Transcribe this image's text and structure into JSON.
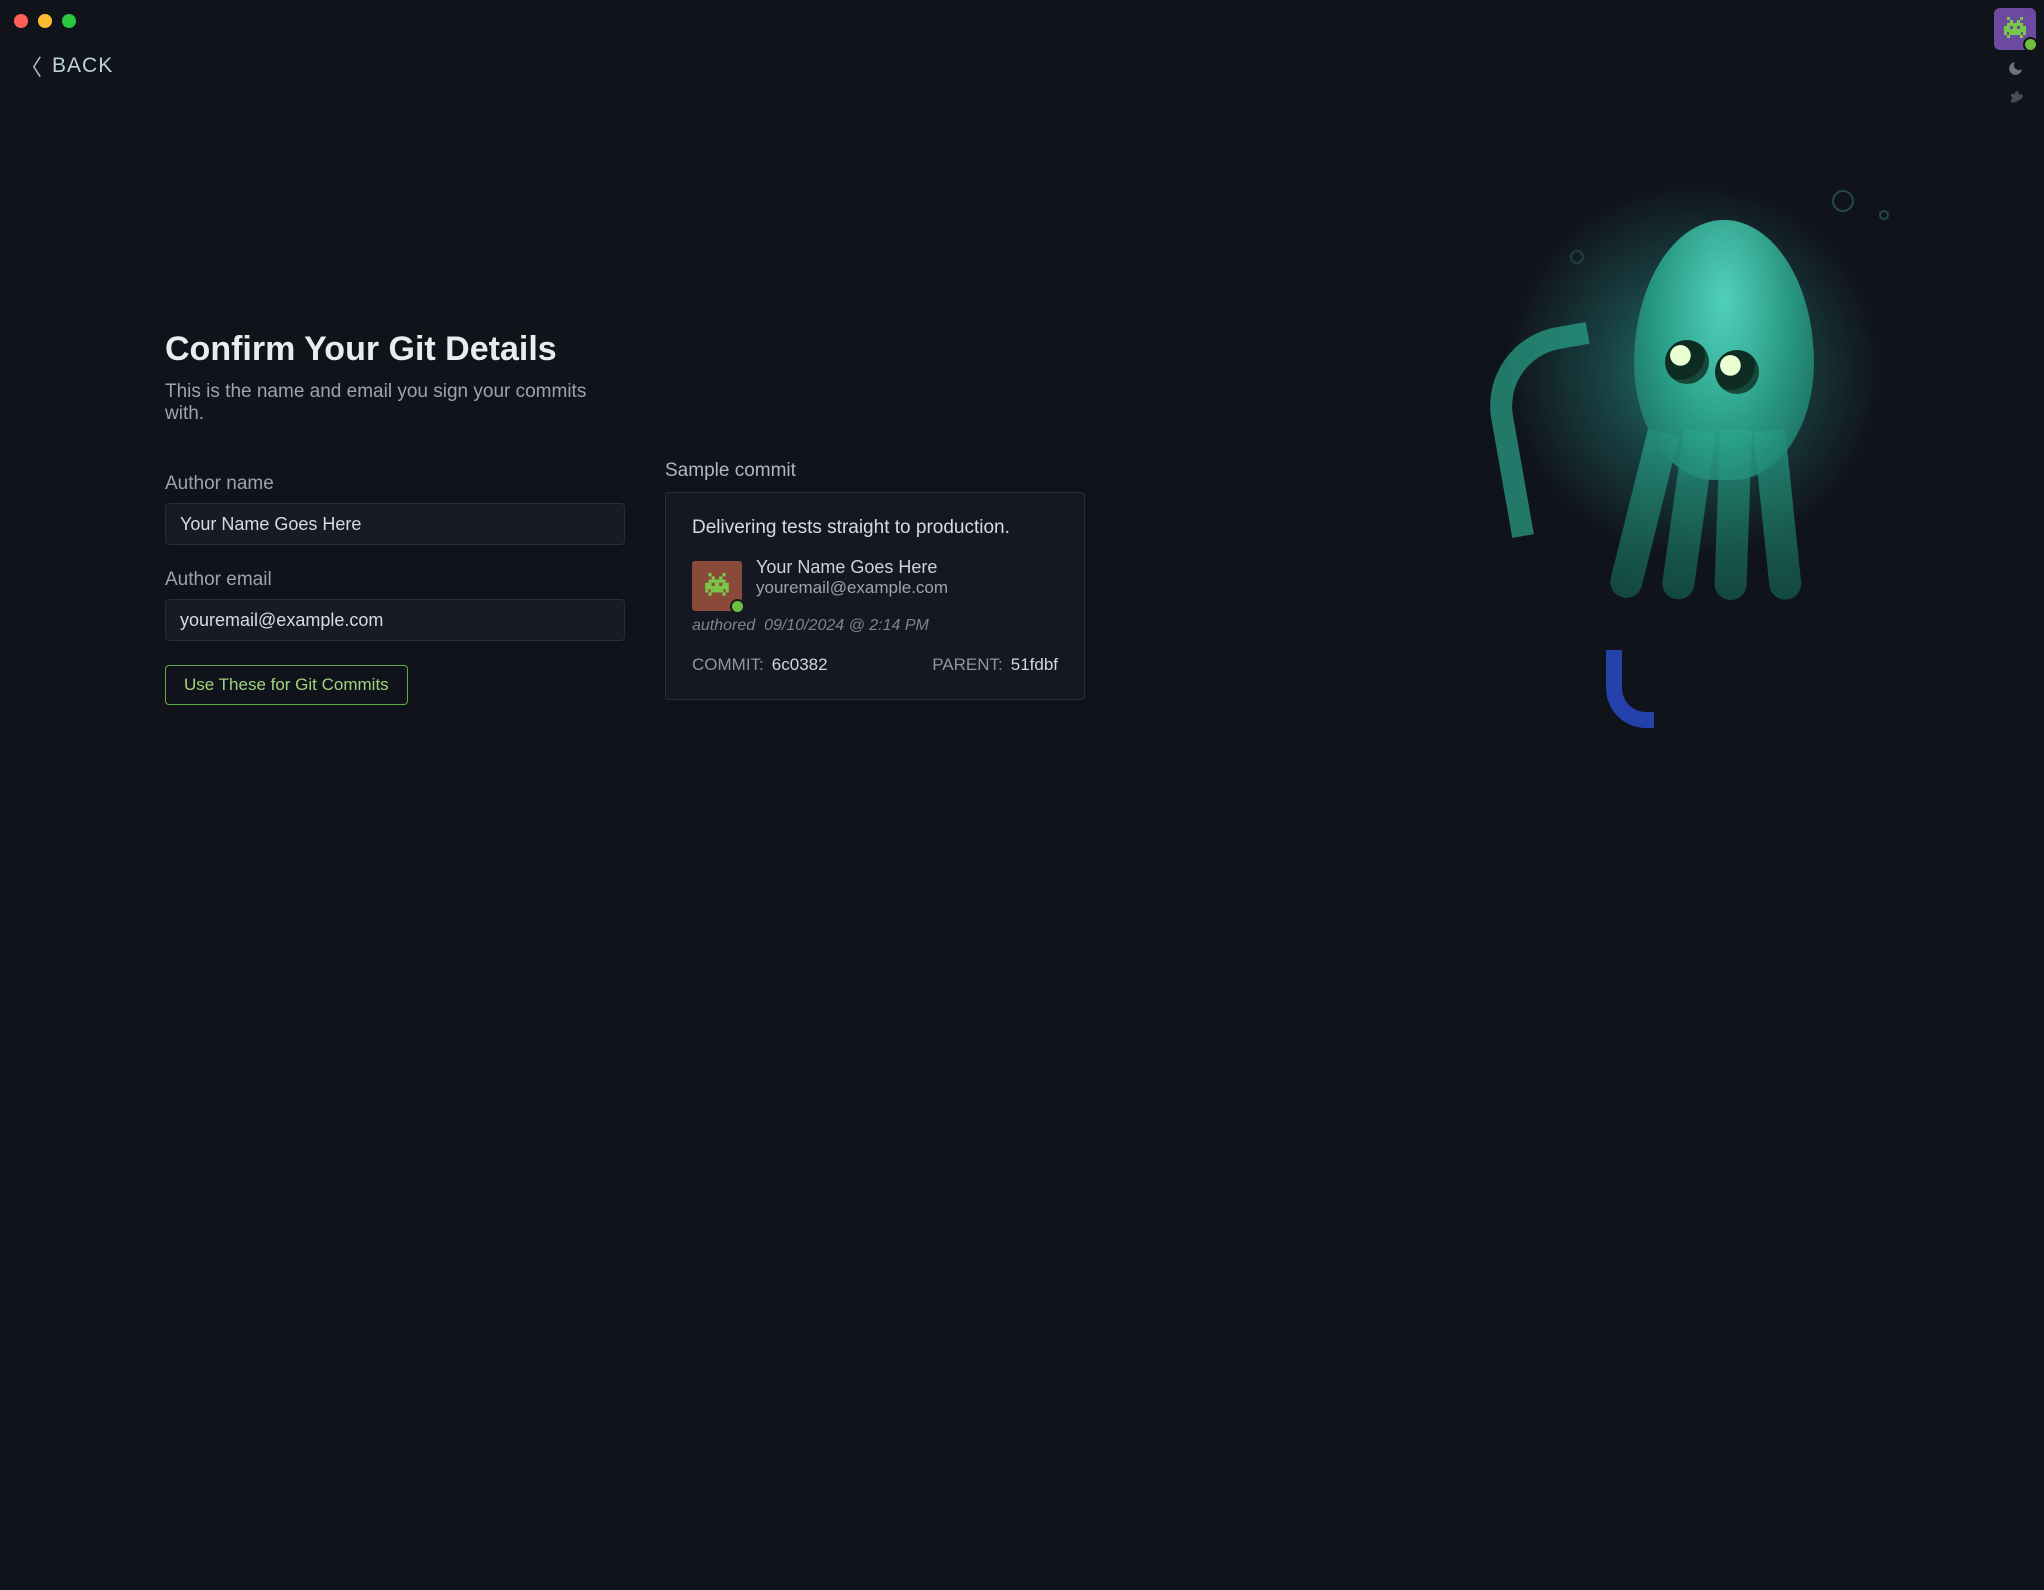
{
  "nav": {
    "back_label": "BACK"
  },
  "page": {
    "heading": "Confirm Your Git Details",
    "subtitle": "This is the name and email you sign your commits with."
  },
  "form": {
    "author_name_label": "Author name",
    "author_name_value": "Your Name Goes Here",
    "author_email_label": "Author email",
    "author_email_value": "youremail@example.com",
    "submit_label": "Use These for Git Commits"
  },
  "preview": {
    "section_label": "Sample commit",
    "message": "Delivering tests straight to production.",
    "author_name": "Your Name Goes Here",
    "author_email": "youremail@example.com",
    "authored_word": "authored",
    "authored_timestamp": "09/10/2024 @ 2:14 PM",
    "commit_label": "COMMIT:",
    "commit_hash": "6c0382",
    "parent_label": "PARENT:",
    "parent_hash": "51fdbf"
  }
}
